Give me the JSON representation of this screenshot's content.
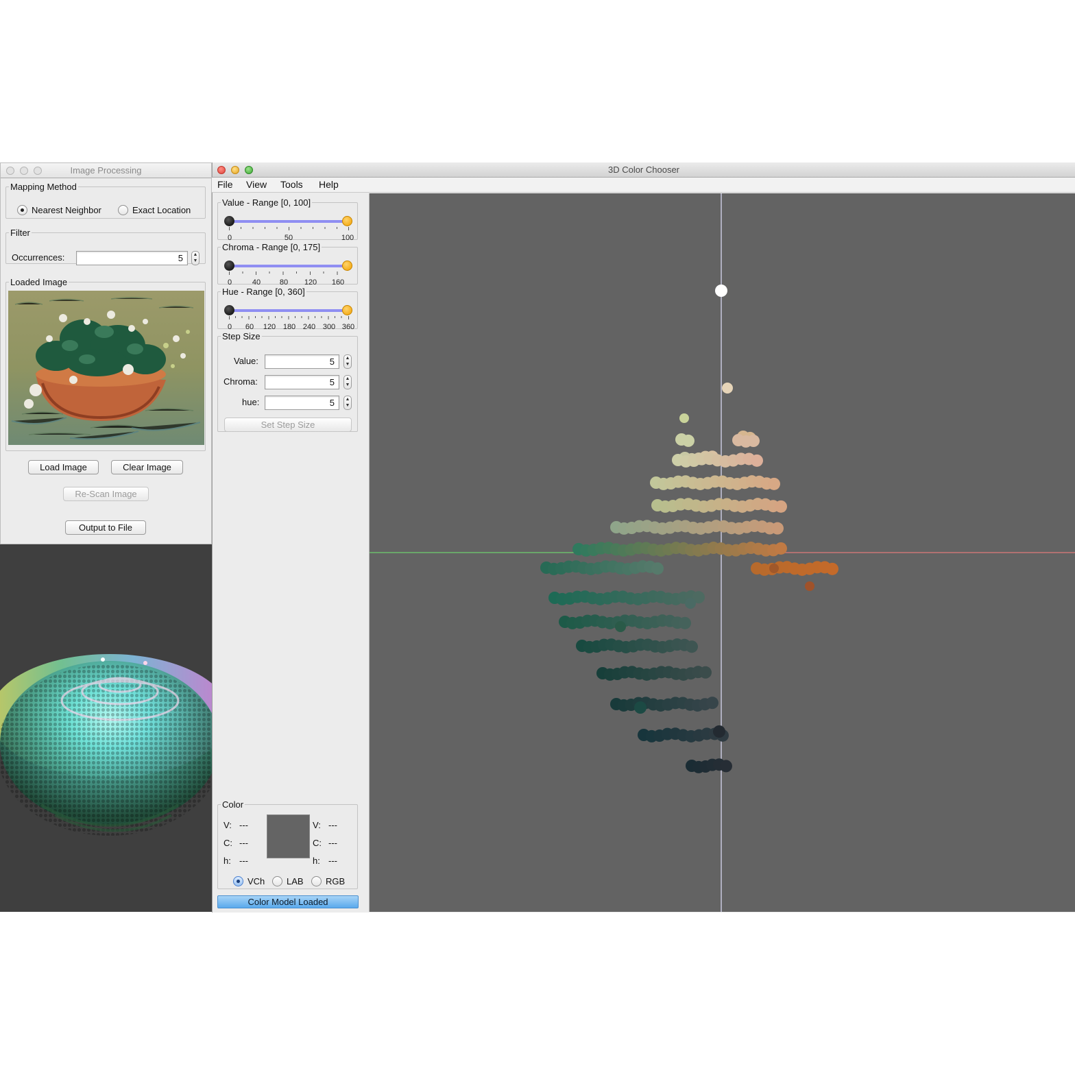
{
  "image_processing_window": {
    "title": "Image Processing",
    "mapping_method": {
      "legend": "Mapping Method",
      "options": [
        "Nearest Neighbor",
        "Exact Location"
      ],
      "selected": "Nearest Neighbor"
    },
    "filter": {
      "legend": "Filter",
      "occurrences_label": "Occurrences:",
      "occurrences_value": "5"
    },
    "loaded_image_legend": "Loaded Image",
    "buttons": {
      "load": "Load Image",
      "clear": "Clear Image",
      "rescan": "Re-Scan Image",
      "output": "Output to File"
    }
  },
  "color_chooser_window": {
    "title": "3D Color Chooser",
    "menu": [
      "File",
      "View",
      "Tools",
      "Help"
    ],
    "value_range": {
      "legend": "Value - Range [0, 100]",
      "ticks": [
        "0",
        "50",
        "100"
      ],
      "low": 0,
      "high": 100
    },
    "chroma_range": {
      "legend": "Chroma - Range [0, 175]",
      "ticks": [
        "0",
        "40",
        "80",
        "120",
        "160"
      ],
      "low": 0,
      "high": 175
    },
    "hue_range": {
      "legend": "Hue - Range [0, 360]",
      "ticks": [
        "0",
        "60",
        "120",
        "180",
        "240",
        "300",
        "360"
      ],
      "low": 0,
      "high": 360
    },
    "step_size": {
      "legend": "Step Size",
      "value_label": "Value:",
      "value": "5",
      "chroma_label": "Chroma:",
      "chroma": "5",
      "hue_label": "hue:",
      "hue": "5",
      "button": "Set Step Size"
    },
    "color": {
      "legend": "Color",
      "left": {
        "v_label": "V:",
        "v": "---",
        "c_label": "C:",
        "c": "---",
        "h_label": "h:",
        "h": "---"
      },
      "right": {
        "v_label": "V:",
        "v": "---",
        "c_label": "C:",
        "c": "---",
        "h_label": "h:",
        "h": "---"
      },
      "swatch_color": "#646464",
      "models": [
        "VCh",
        "LAB",
        "RGB"
      ],
      "selected_model": "VCh"
    },
    "status": "Color Model Loaded"
  },
  "colors": {
    "viewport_bg": "#636363",
    "secondary_viewport_bg": "#3f3f3f",
    "axis_vertical": "#e8e8ff",
    "axis_green": "#6fd06f",
    "axis_red": "#e07a7a",
    "status_blue": "#6fb6ef"
  },
  "icons": {
    "radio": "radio-button",
    "spinner": "spinner-arrows",
    "traffic_lights": [
      "close",
      "minimize",
      "zoom"
    ]
  }
}
